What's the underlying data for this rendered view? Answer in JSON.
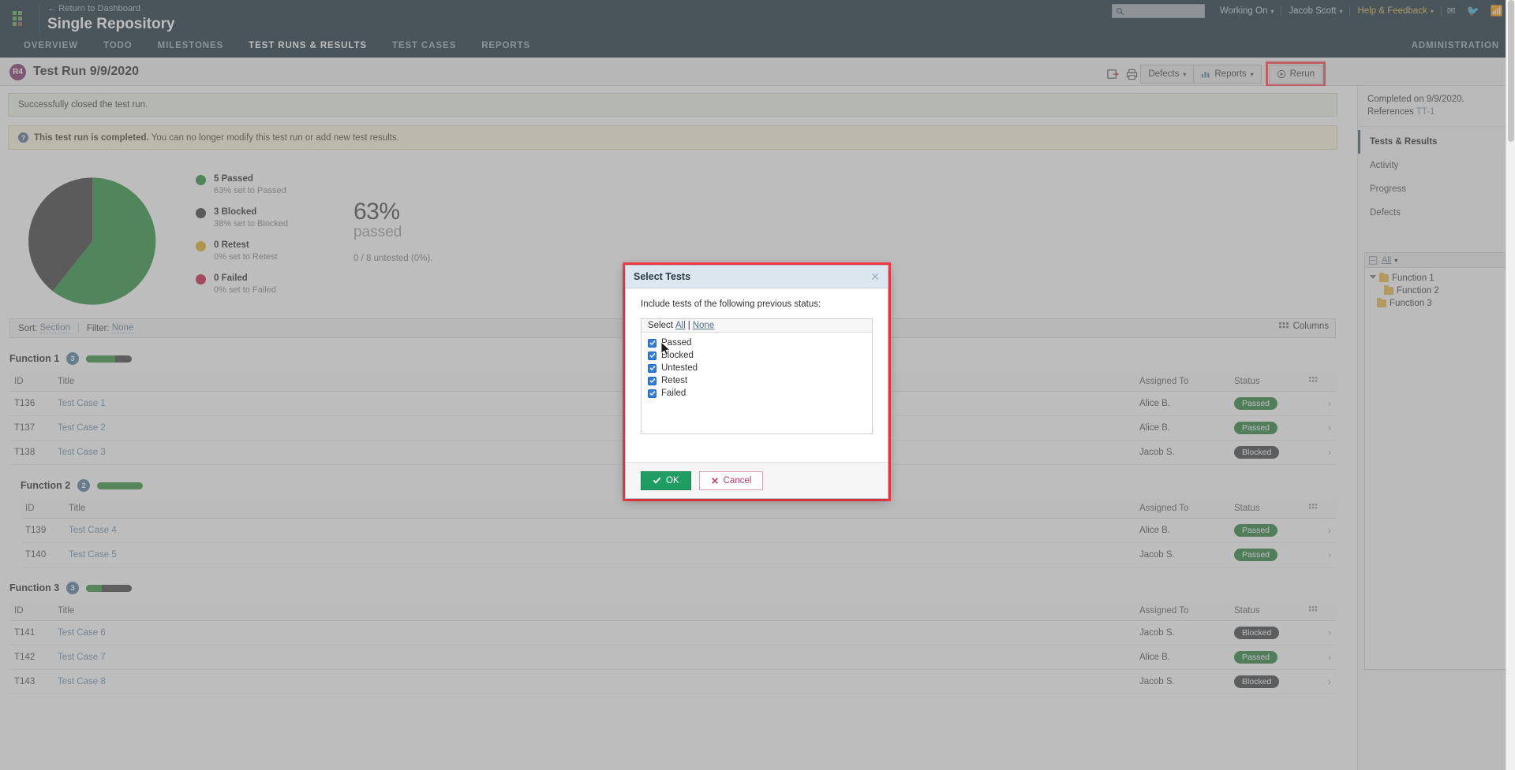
{
  "header": {
    "return_link": "← Return to Dashboard",
    "repo_title": "Single Repository",
    "tabs": [
      {
        "label": "OVERVIEW",
        "active": false
      },
      {
        "label": "TODO",
        "active": false
      },
      {
        "label": "MILESTONES",
        "active": false
      },
      {
        "label": "TEST RUNS & RESULTS",
        "active": true
      },
      {
        "label": "TEST CASES",
        "active": false
      },
      {
        "label": "REPORTS",
        "active": false
      }
    ],
    "administration": "ADMINISTRATION",
    "search_placeholder": "",
    "search_value": "",
    "working_on": "Working On",
    "user": "Jacob Scott",
    "help": "Help & Feedback"
  },
  "titlebar": {
    "run_badge": "R4",
    "run_title": "Test Run 9/9/2020",
    "defects_label": "Defects",
    "reports_label": "Reports",
    "rerun_label": "Rerun"
  },
  "sidebar": {
    "completed_text": "Completed on 9/9/2020.",
    "references_label": "References",
    "references_value": "TT-1",
    "items": [
      {
        "label": "Tests & Results",
        "active": true
      },
      {
        "label": "Activity",
        "active": false
      },
      {
        "label": "Progress",
        "active": false
      },
      {
        "label": "Defects",
        "active": false
      }
    ],
    "tree_filter": "All",
    "tree": [
      {
        "label": "Function 1",
        "depth": 0,
        "expanded": true
      },
      {
        "label": "Function 2",
        "depth": 1,
        "expanded": false
      },
      {
        "label": "Function 3",
        "depth": 0,
        "expanded": false
      }
    ]
  },
  "alerts": {
    "success": "Successfully closed the test run.",
    "info_bold": "This test run is completed.",
    "info_rest": "You can no longer modify this test run or add new test results."
  },
  "chart_data": {
    "type": "pie",
    "title": "Test run status distribution",
    "categories": [
      "Passed",
      "Blocked",
      "Retest",
      "Failed"
    ],
    "values": [
      5,
      3,
      0,
      0
    ],
    "percents": [
      63,
      38,
      0,
      0
    ],
    "colors": [
      "#1f8a33",
      "#333333",
      "#e0a91b",
      "#c4143f"
    ],
    "legend_position": "right",
    "legend": [
      {
        "count": "5 Passed",
        "sub": "63% set to Passed",
        "color": "#1f8a33"
      },
      {
        "count": "3 Blocked",
        "sub": "38% set to Blocked",
        "color": "#333333"
      },
      {
        "count": "0 Retest",
        "sub": "0% set to Retest",
        "color": "#e0a91b"
      },
      {
        "count": "0 Failed",
        "sub": "0% set to Failed",
        "color": "#c4143f"
      }
    ],
    "summary_pct": "63%",
    "summary_word": "passed",
    "summary_sub": "0 / 8 untested (0%)."
  },
  "toolbar": {
    "sort_label": "Sort:",
    "sort_value": "Section",
    "filter_label": "Filter:",
    "filter_value": "None",
    "columns_label": "Columns"
  },
  "table_headers": {
    "id": "ID",
    "title": "Title",
    "assigned": "Assigned To",
    "status": "Status"
  },
  "sections": [
    {
      "name": "Function 1",
      "count": "3",
      "progress_pct": 63,
      "rows": [
        {
          "id": "T136",
          "title": "Test Case 1",
          "assigned": "Alice B.",
          "status": "Passed",
          "status_class": "passed"
        },
        {
          "id": "T137",
          "title": "Test Case 2",
          "assigned": "Alice B.",
          "status": "Passed",
          "status_class": "passed"
        },
        {
          "id": "T138",
          "title": "Test Case 3",
          "assigned": "Jacob S.",
          "status": "Blocked",
          "status_class": "blocked"
        }
      ]
    },
    {
      "name": "Function 2",
      "count": "2",
      "progress_pct": 100,
      "rows": [
        {
          "id": "T139",
          "title": "Test Case 4",
          "assigned": "Alice B.",
          "status": "Passed",
          "status_class": "passed"
        },
        {
          "id": "T140",
          "title": "Test Case 5",
          "assigned": "Jacob S.",
          "status": "Passed",
          "status_class": "passed"
        }
      ]
    },
    {
      "name": "Function 3",
      "count": "3",
      "progress_pct": 34,
      "rows": [
        {
          "id": "T141",
          "title": "Test Case 6",
          "assigned": "Jacob S.",
          "status": "Blocked",
          "status_class": "blocked"
        },
        {
          "id": "T142",
          "title": "Test Case 7",
          "assigned": "Alice B.",
          "status": "Passed",
          "status_class": "passed"
        },
        {
          "id": "T143",
          "title": "Test Case 8",
          "assigned": "Jacob S.",
          "status": "Blocked",
          "status_class": "blocked"
        }
      ]
    }
  ],
  "modal": {
    "title": "Select Tests",
    "question": "Include tests of the following previous status:",
    "select_label": "Select",
    "select_all": "All",
    "select_sep": "|",
    "select_none": "None",
    "options": [
      {
        "label": "Passed",
        "checked": true
      },
      {
        "label": "Blocked",
        "checked": true
      },
      {
        "label": "Untested",
        "checked": true
      },
      {
        "label": "Retest",
        "checked": true
      },
      {
        "label": "Failed",
        "checked": true
      }
    ],
    "ok_label": "OK",
    "cancel_label": "Cancel"
  },
  "colors": {
    "nav_bg": "#0e2433",
    "accent_red": "#ff3b47",
    "passed_green": "#1f7a33",
    "blocked_dark": "#33383a",
    "link_blue": "#6b8ca5"
  }
}
